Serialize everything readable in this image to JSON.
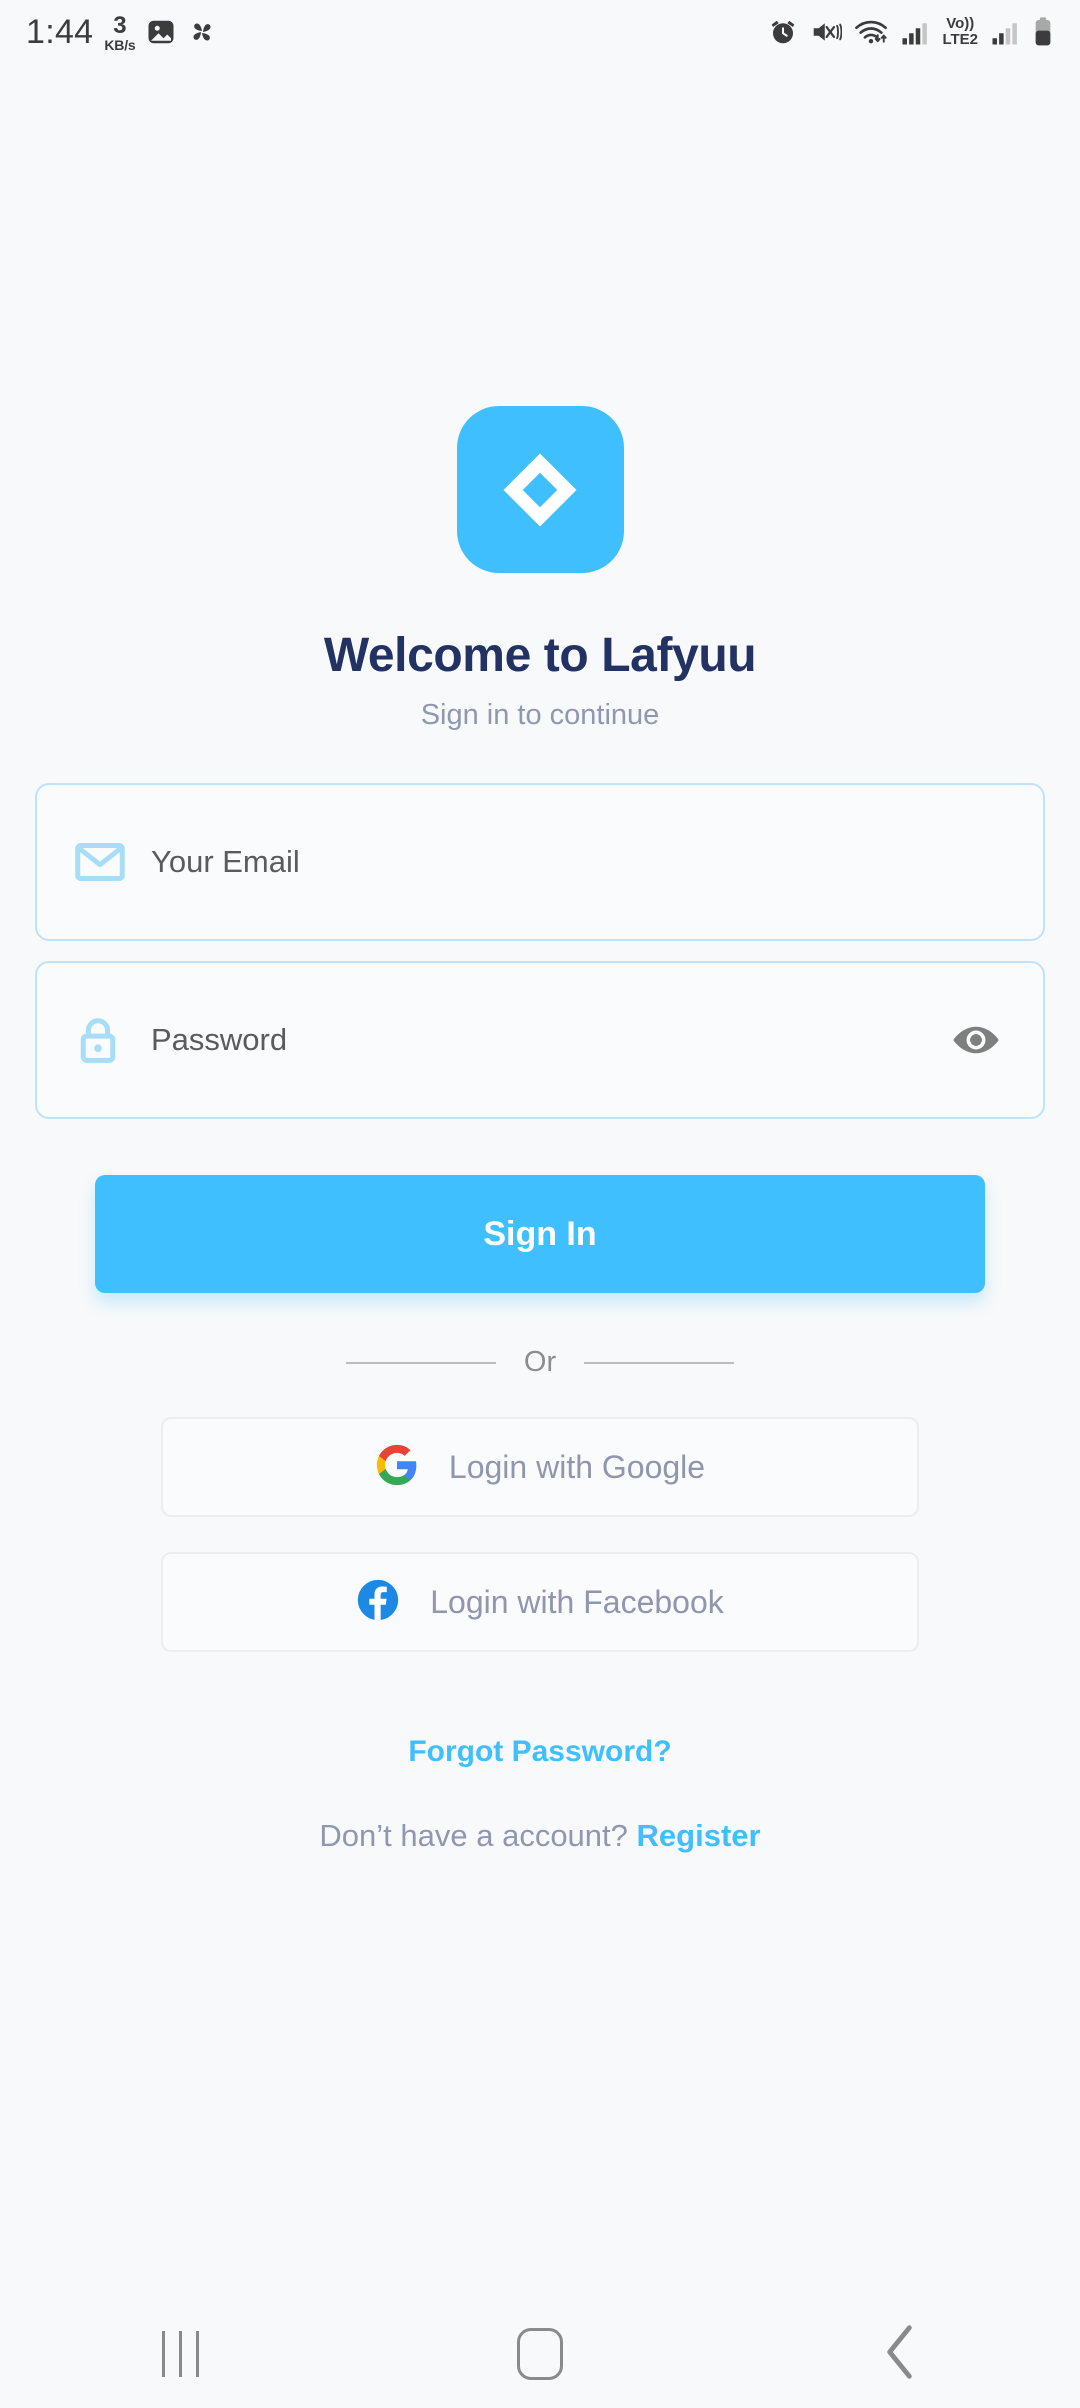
{
  "status_bar": {
    "time": "1:44",
    "net_speed_value": "3",
    "net_speed_unit": "KB/s",
    "icons_left": [
      "image-icon",
      "pinwheel-icon"
    ],
    "icons_right": [
      "alarm-icon",
      "mute-vibrate-icon",
      "wifi-icon",
      "signal-icon",
      "volte-icon",
      "signal2-icon",
      "battery-icon"
    ],
    "volte_top": "Vo))",
    "volte_bottom": "LTE2"
  },
  "brand": {
    "logo_name": "lafyuu-diamond-logo",
    "logo_bg": "#40bfff"
  },
  "header": {
    "title": "Welcome to Lafyuu",
    "subtitle": "Sign in to continue",
    "title_color": "#223263",
    "subtitle_color": "#9098b1"
  },
  "form": {
    "email": {
      "placeholder": "Your Email",
      "value": "",
      "icon": "envelope-icon"
    },
    "password": {
      "placeholder": "Password",
      "value": "",
      "icon": "lock-icon",
      "toggle_icon": "eye-icon"
    },
    "submit_label": "Sign In",
    "submit_color": "#40bfff"
  },
  "divider": {
    "label": "Or"
  },
  "social": [
    {
      "label": "Login with Google",
      "icon": "google-icon"
    },
    {
      "label": "Login with Facebook",
      "icon": "facebook-icon"
    }
  ],
  "links": {
    "forgot_password": "Forgot Password?",
    "no_account_text": "Don’t have a account?",
    "register": "Register",
    "link_color": "#40bfff"
  },
  "navbar": {
    "recents": "recents-button",
    "home": "home-button",
    "back": "back-button"
  }
}
